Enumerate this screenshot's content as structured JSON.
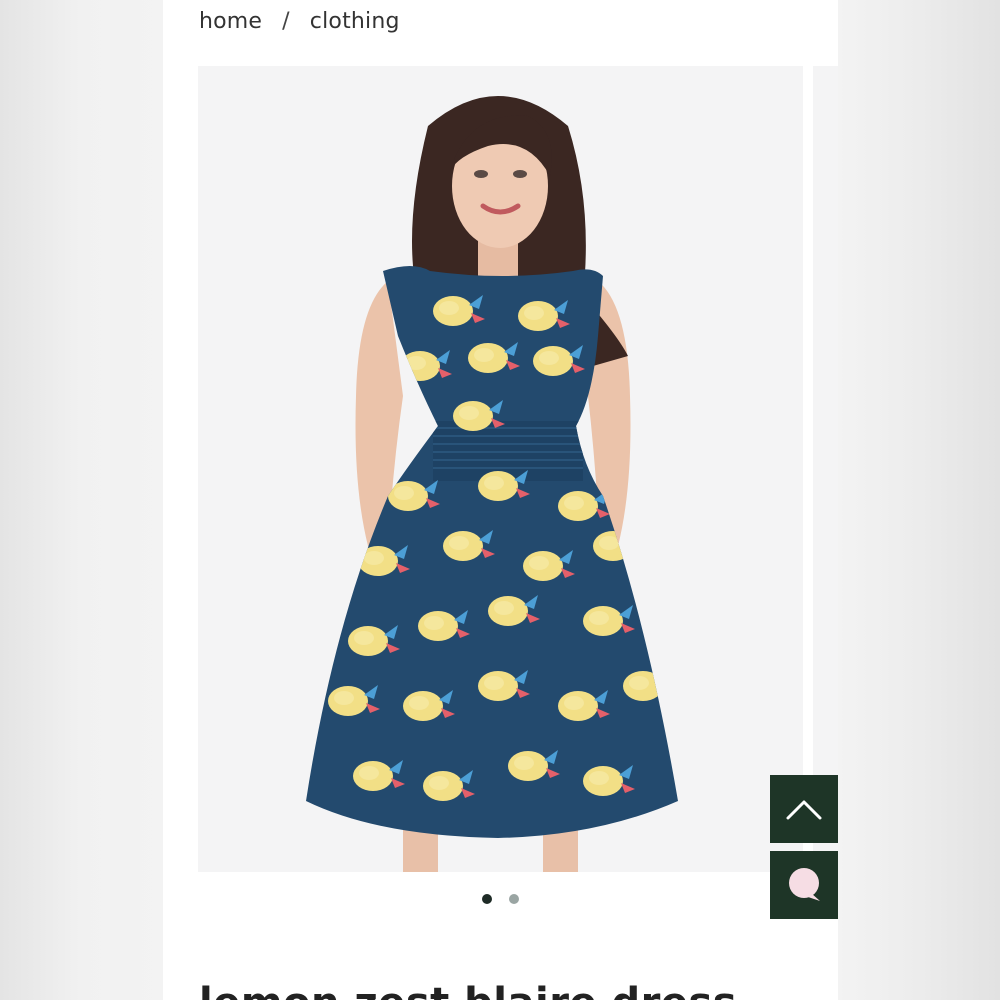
{
  "breadcrumb": {
    "home": "home",
    "separator": "/",
    "current": "clothing"
  },
  "product": {
    "title": "lemon zest blaire dress"
  },
  "gallery": {
    "image_count": 2,
    "active_index": 0
  },
  "floating_buttons": {
    "scroll_top_icon": "chevron-up-icon",
    "chat_icon": "chat-bubble-icon"
  },
  "colors": {
    "brand_dark": "#1e3527",
    "dress_navy": "#234a6e",
    "lemon": "#f2df86",
    "dot_active": "#1e2b26",
    "dot_inactive": "#9aa5a3"
  }
}
